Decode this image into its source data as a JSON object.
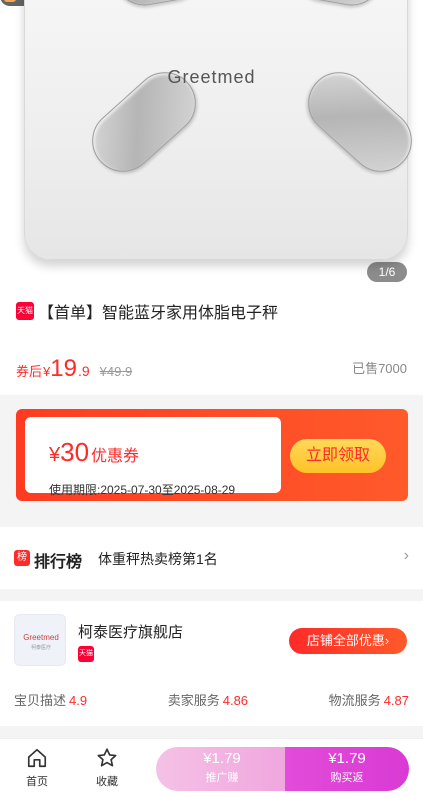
{
  "product": {
    "brand": "Greetmed",
    "image_indicator": "1/6",
    "tmall_badge": "天猫",
    "title": "【首单】智能蓝牙家用体脂电子秤",
    "price_after_label": "券后",
    "currency": "¥",
    "price_int": "19",
    "price_dec": ".9",
    "original_price": "¥49.9",
    "sold": "已售7000"
  },
  "coupon": {
    "currency": "¥",
    "amount": "30",
    "label": "优惠券",
    "validity": "使用期限:2025-07-30至2025-08-29",
    "claim_button": "立即领取"
  },
  "ranking": {
    "icon": "榜",
    "logo": "排行榜",
    "text": "体重秤热卖榜第1名",
    "arrow": "›"
  },
  "shop": {
    "logo_name": "Greetmed",
    "logo_sub": "柯泰医疗",
    "name": "柯泰医疗旗舰店",
    "tmall_badge": "天猫",
    "all_coupons_button": "店铺全部优惠›",
    "ratings": [
      {
        "label": "宝贝描述",
        "value": "4.9"
      },
      {
        "label": "卖家服务",
        "value": "4.86"
      },
      {
        "label": "物流服务",
        "value": "4.87"
      }
    ]
  },
  "bottom_bar": {
    "home_label": "首页",
    "favorite_label": "收藏",
    "promote_price": "¥1.79",
    "promote_label": "推广赚",
    "buy_price": "¥1.79",
    "buy_label": "购买返"
  },
  "colors": {
    "accent_red": "#ff2a2a",
    "tmall_red": "#ff0036",
    "coupon_yellow": "#ffc227",
    "promote_pink": "#f0a6de",
    "buy_magenta": "#d93ad4"
  }
}
